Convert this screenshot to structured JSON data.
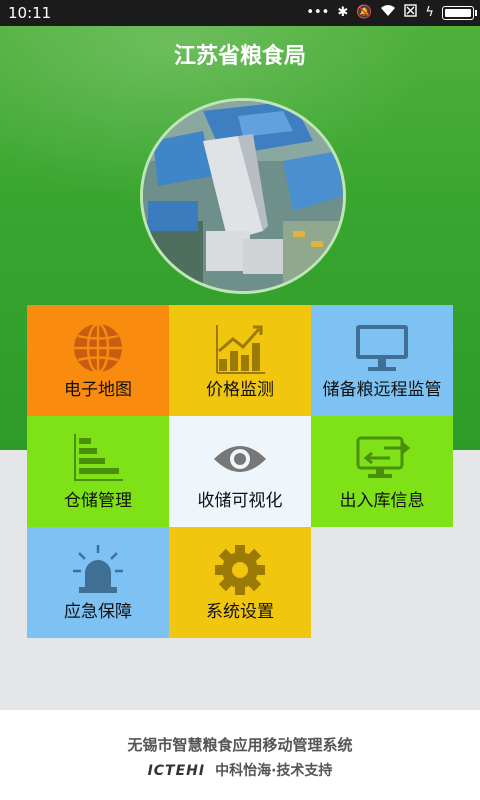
{
  "status_bar": {
    "time": "10:11",
    "icons": [
      "more-dots-icon",
      "bluetooth-icon",
      "mute-icon",
      "wifi-icon",
      "sim-off-icon",
      "charging-icon",
      "battery-icon"
    ]
  },
  "header": {
    "title": "江苏省粮食局"
  },
  "menu": {
    "items": [
      {
        "label": "电子地图",
        "icon": "globe-icon",
        "color": "#f98b0f"
      },
      {
        "label": "价格监测",
        "icon": "price-chart-icon",
        "color": "#f1c60e"
      },
      {
        "label": "储备粮远程监管",
        "icon": "monitor-icon",
        "color": "#7dc2f2"
      },
      {
        "label": "仓储管理",
        "icon": "storage-bars-icon",
        "color": "#7ee217"
      },
      {
        "label": "收储可视化",
        "icon": "eye-icon",
        "color": "#eef6fb"
      },
      {
        "label": "出入库信息",
        "icon": "transfer-screen-icon",
        "color": "#7ee217"
      },
      {
        "label": "应急保障",
        "icon": "alarm-light-icon",
        "color": "#7dc2f2"
      },
      {
        "label": "系统设置",
        "icon": "gear-icon",
        "color": "#f1c60e"
      }
    ]
  },
  "footer": {
    "title": "无锡市智慧粮食应用移动管理系统",
    "logo": "ICTEHI",
    "support": "中科怡海·技术支持"
  }
}
